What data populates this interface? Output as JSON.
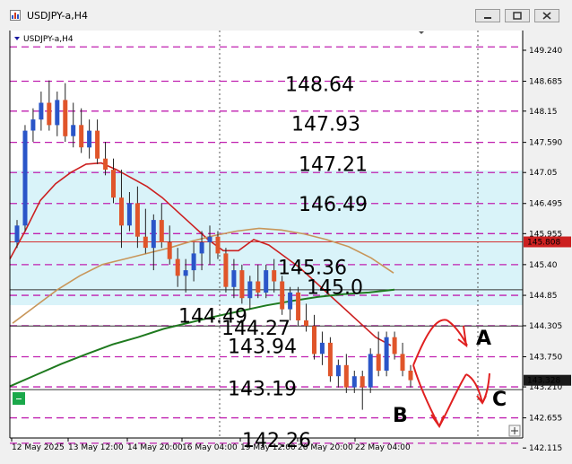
{
  "window": {
    "title": "USDJPY-a,H4"
  },
  "chart_data": {
    "type": "candlestick",
    "symbol_label": "USDJPY-a,H4",
    "price_axis": {
      "ylim": [
        141.9,
        149.5
      ],
      "ticks": [
        "149.240",
        "148.685",
        "148.15",
        "147.590",
        "147.05",
        "146.495",
        "145.955",
        "145.40",
        "144.85",
        "144.305",
        "143.750",
        "143.210",
        "142.655",
        "142.115"
      ]
    },
    "date_axis": [
      "12 May 2025",
      "13 May 12:00",
      "14 May 20:00",
      "16 May 04:00",
      "19 May 12:00",
      "20 May 20:00",
      "22 May 04:00"
    ],
    "current_price": {
      "label": "145.808",
      "value": 145.808,
      "color": "#cc2020"
    },
    "bid_price": {
      "label": "143.328",
      "value": 143.328
    },
    "dashed_levels": [
      149.3,
      148.685,
      148.15,
      147.59,
      147.05,
      146.495,
      145.955,
      145.4,
      144.85,
      144.305,
      143.75,
      143.21,
      142.655,
      142.2
    ],
    "solid_levels": [
      145.808,
      144.95,
      144.3,
      143.16
    ],
    "annotations": [
      {
        "text": "148.64",
        "value": 148.64
      },
      {
        "text": "147.93",
        "value": 147.93
      },
      {
        "text": "147.21",
        "value": 147.21
      },
      {
        "text": "146.49",
        "value": 146.49
      },
      {
        "text": "145.36",
        "value": 145.36
      },
      {
        "text": "145.0",
        "value": 145.0
      },
      {
        "text": "144.49",
        "value": 144.49
      },
      {
        "text": "144.27",
        "value": 144.27
      },
      {
        "text": "143.94",
        "value": 143.94
      },
      {
        "text": "143.19",
        "value": 143.19
      },
      {
        "text": "142.26",
        "value": 142.26
      }
    ],
    "scenario_labels": [
      "A",
      "B",
      "C"
    ],
    "series": [
      {
        "name": "",
        "color": "#cc2020",
        "values": [
          145.5,
          146.0,
          146.55,
          146.85,
          147.05,
          147.2,
          147.22,
          147.1,
          146.95,
          146.8,
          146.6,
          146.35,
          146.1,
          145.85,
          145.65,
          145.65,
          145.85,
          145.75,
          145.55,
          145.35,
          145.1,
          144.85,
          144.6,
          144.35,
          144.1,
          143.95
        ]
      },
      {
        "name": "",
        "color": "#c8965a",
        "values": [
          144.35,
          144.65,
          144.95,
          145.2,
          145.4,
          145.5,
          145.6,
          145.7,
          145.82,
          145.92,
          146.0,
          146.05,
          146.02,
          145.95,
          145.85,
          145.72,
          145.52,
          145.25
        ]
      },
      {
        "name": "",
        "color": "#1f7a1f",
        "values": [
          143.22,
          143.42,
          143.62,
          143.8,
          143.97,
          144.1,
          144.25,
          144.36,
          144.47,
          144.57,
          144.67,
          144.75,
          144.82,
          144.87,
          144.9,
          144.95
        ]
      }
    ],
    "candles": [
      [
        145.8,
        146.2,
        145.7,
        146.1
      ],
      [
        146.1,
        147.9,
        146.0,
        147.8
      ],
      [
        147.8,
        148.2,
        147.6,
        148.0
      ],
      [
        148.0,
        148.5,
        147.8,
        148.3
      ],
      [
        148.3,
        148.7,
        147.8,
        147.9
      ],
      [
        147.9,
        148.5,
        147.7,
        148.35
      ],
      [
        148.35,
        148.65,
        147.6,
        147.7
      ],
      [
        147.7,
        148.3,
        147.5,
        147.9
      ],
      [
        147.9,
        148.2,
        147.4,
        147.5
      ],
      [
        147.5,
        148.0,
        147.3,
        147.8
      ],
      [
        147.8,
        148.0,
        147.2,
        147.3
      ],
      [
        147.3,
        147.6,
        147.0,
        147.1
      ],
      [
        147.1,
        147.3,
        146.5,
        146.6
      ],
      [
        146.6,
        147.1,
        145.7,
        146.1
      ],
      [
        146.1,
        146.7,
        146.0,
        146.5
      ],
      [
        146.5,
        146.8,
        145.7,
        145.9
      ],
      [
        145.9,
        146.4,
        145.6,
        145.7
      ],
      [
        145.7,
        146.3,
        145.3,
        146.2
      ],
      [
        146.2,
        146.5,
        145.7,
        145.8
      ],
      [
        145.8,
        146.1,
        145.4,
        145.5
      ],
      [
        145.5,
        145.7,
        145.0,
        145.2
      ],
      [
        145.2,
        145.5,
        144.9,
        145.3
      ],
      [
        145.3,
        145.8,
        145.1,
        145.6
      ],
      [
        145.6,
        146.0,
        145.3,
        145.8
      ],
      [
        145.8,
        146.1,
        145.4,
        145.9
      ],
      [
        145.9,
        146.0,
        145.5,
        145.6
      ],
      [
        145.6,
        145.7,
        144.9,
        145.0
      ],
      [
        145.0,
        145.5,
        144.8,
        145.3
      ],
      [
        145.3,
        145.4,
        144.7,
        144.8
      ],
      [
        144.8,
        145.2,
        144.6,
        145.1
      ],
      [
        145.1,
        145.4,
        144.8,
        144.9
      ],
      [
        144.9,
        145.4,
        144.8,
        145.3
      ],
      [
        145.3,
        145.5,
        144.9,
        145.1
      ],
      [
        145.1,
        145.2,
        144.5,
        144.6
      ],
      [
        144.6,
        145.0,
        144.4,
        144.9
      ],
      [
        144.9,
        145.0,
        144.3,
        144.4
      ],
      [
        144.4,
        144.7,
        144.2,
        144.3
      ],
      [
        144.3,
        144.5,
        143.7,
        143.8
      ],
      [
        143.8,
        144.2,
        143.6,
        144.0
      ],
      [
        144.0,
        144.1,
        143.3,
        143.4
      ],
      [
        143.4,
        143.7,
        143.2,
        143.6
      ],
      [
        143.6,
        143.8,
        143.1,
        143.2
      ],
      [
        143.2,
        143.5,
        143.1,
        143.4
      ],
      [
        143.4,
        143.5,
        142.8,
        143.2
      ],
      [
        143.2,
        143.9,
        143.1,
        143.8
      ],
      [
        143.8,
        144.2,
        143.4,
        143.5
      ],
      [
        143.5,
        144.2,
        143.4,
        144.1
      ],
      [
        144.1,
        144.2,
        143.7,
        143.8
      ],
      [
        143.8,
        144.0,
        143.4,
        143.5
      ],
      [
        143.5,
        143.6,
        143.2,
        143.33
      ]
    ]
  }
}
